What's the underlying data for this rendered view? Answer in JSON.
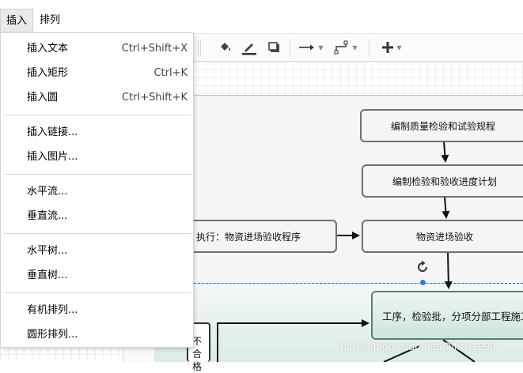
{
  "menubar": {
    "insert": "插入",
    "arrange": "排列"
  },
  "toolbar": {
    "fill_icon": "paint-bucket-icon",
    "line_color_icon": "pencil-line-icon",
    "shadow_icon": "shadow-icon",
    "connection_icon": "arrow-right-icon",
    "waypoints_icon": "waypoint-icon",
    "insert_icon": "plus-icon"
  },
  "dropdown": {
    "insert_text": {
      "label": "插入文本",
      "shortcut": "Ctrl+Shift+X"
    },
    "insert_rect": {
      "label": "插入矩形",
      "shortcut": "Ctrl+K"
    },
    "insert_ellipse": {
      "label": "插入圆",
      "shortcut": "Ctrl+Shift+K"
    },
    "insert_link": "插入链接...",
    "insert_image": "插入图片...",
    "horizontal_flow": "水平流...",
    "vertical_flow": "垂直流...",
    "horizontal_tree": "水平树...",
    "vertical_tree": "垂直树...",
    "organic_layout": "有机排列...",
    "circle_layout": "圆形排列..."
  },
  "diagram": {
    "node1": "编制质量检验和试验规程",
    "node2": "编制检验和验收进度计划",
    "node3": "执行：物资进场验收程序",
    "node4": "物资进场验收",
    "node5": "工序，检验批，分项分部工程施工",
    "node6": "不合格"
  },
  "watermark": "https://blog.csdn.net/Office1998"
}
